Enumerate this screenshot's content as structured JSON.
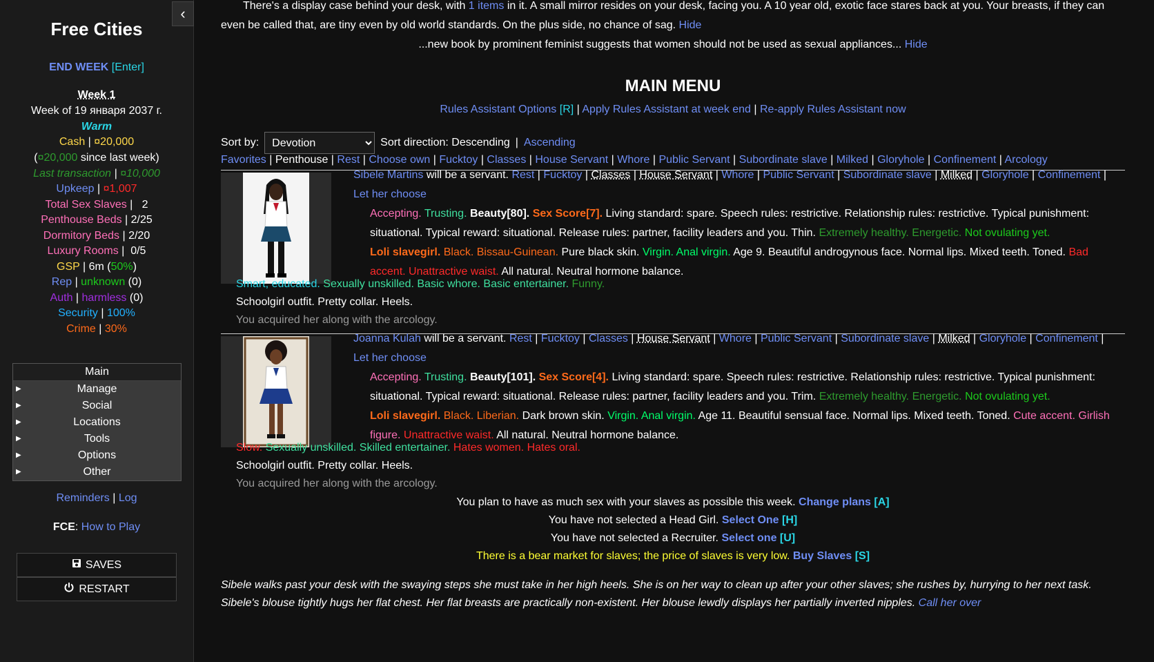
{
  "sidebar": {
    "title": "Free Cities",
    "end_week": "END WEEK",
    "end_week_key": "[Enter]",
    "week": "Week 1",
    "date": "Week of 19 января 2037 г.",
    "weather": "Warm",
    "cash_label": "Cash",
    "cash_value": "¤20,000",
    "cash_change": "¤20,000",
    "since_last_week": "since last week)",
    "last_tx_label": "Last transaction",
    "last_tx_value": "¤10,000",
    "upkeep_label": "Upkeep",
    "upkeep_value": "¤1,007",
    "sex_slaves_label": "Total Sex Slaves",
    "sex_slaves_value": "2",
    "penthouse_beds_label": "Penthouse Beds",
    "penthouse_beds_value": "2/25",
    "dormitory_beds_label": "Dormitory Beds",
    "dormitory_beds_value": "2/20",
    "luxury_rooms_label": "Luxury Rooms",
    "luxury_rooms_value": "0/5",
    "gsp_label": "GSP",
    "gsp_value": "6m",
    "gsp_pct": "50%",
    "rep_label": "Rep",
    "rep_value": "unknown",
    "rep_num": "(0)",
    "auth_label": "Auth",
    "auth_value": "harmless",
    "auth_num": "(0)",
    "security_label": "Security",
    "security_value": "100%",
    "crime_label": "Crime",
    "crime_value": "30%",
    "menu": [
      "Main",
      "Manage",
      "Social",
      "Locations",
      "Tools",
      "Options",
      "Other"
    ],
    "reminders": "Reminders",
    "log": "Log",
    "fce": "FCE",
    "how_to_play": "How to Play",
    "saves": "SAVES",
    "restart": "RESTART"
  },
  "main": {
    "desk_text": "There's a display case behind your desk, with",
    "items_link": "1 items",
    "desk_text2": "in it. A small mirror resides on your desk, facing you. A 10 year old, exotic face stares back at you. Your breasts, if they can",
    "desk_text3": "even be called that, are tiny even by old world standards. On the plus side, no chance of sag.",
    "hide": "Hide",
    "news": "...new book by prominent feminist suggests that women should not be used as sexual appliances...",
    "menu_title": "MAIN MENU",
    "rules_assistant": "Rules Assistant Options",
    "rules_key": "[R]",
    "apply_rules": "Apply Rules Assistant at week end",
    "reapply_rules": "Re-apply Rules Assistant now",
    "sort_by": "Sort by:",
    "sort_selected": "Devotion",
    "sort_direction": "Sort direction: Descending",
    "ascending": "Ascending",
    "filters": [
      "Favorites",
      "Penthouse",
      "Rest",
      "Choose own",
      "Fucktoy",
      "Classes",
      "House Servant",
      "Whore",
      "Public Servant",
      "Subordinate slave",
      "Milked",
      "Gloryhole",
      "Confinement",
      "Arcology"
    ],
    "plan_text": "You plan to have as much sex with your slaves as possible this week.",
    "change_plans": "Change plans",
    "change_plans_key": "[A]",
    "headgirl_text": "You have not selected a Head Girl.",
    "select_one_h": "Select One",
    "key_h": "[H]",
    "recruiter_text": "You have not selected a Recruiter.",
    "select_one_u": "Select one",
    "key_u": "[U]",
    "market_text": "There is a bear market for slaves; the price of slaves is very low.",
    "buy_slaves": "Buy Slaves",
    "key_s": "[S]",
    "event_line1": "Sibele walks past your desk with the swaying steps she must take in her high heels. She is on her way to clean up after your other slaves; she rushes by, hurrying to her next task.",
    "event_line2": "Sibele's blouse tightly hugs her flat chest. Her flat breasts are practically non-existent. Her blouse lewdly displays her partially inverted nipples.",
    "call_her_over": "Call her over"
  },
  "slaves": [
    {
      "name": "Sibele Martins",
      "will_be": "will be a servant.",
      "assign": [
        "Rest",
        "Fucktoy",
        "Classes",
        "House Servant",
        "Whore",
        "Public Servant",
        "Subordinate slave",
        "Milked",
        "Gloryhole",
        "Confinement",
        "Let"
      ],
      "assign_wrap": "her choose",
      "accepting": "Accepting.",
      "trusting": "Trusting.",
      "beauty": "Beauty[80].",
      "sex_score": "Sex Score[7].",
      "rules1": "Living standard: spare. Speech rules: restrictive. Relationship rules: restrictive. Typical punishment:",
      "rules2": "situational. Typical reward: situational. Release rules: partner, facility leaders and you. Thin.",
      "health": "Extremely healthy. Energetic.",
      "ovulating": "Not ovulating yet.",
      "slavegirl": "Loli slavegirl.",
      "race": "Black.",
      "nation": "Bissau-Guinean.",
      "skin": "Pure black skin.",
      "virgin": "Virgin. Anal virgin.",
      "desc": "Age 9. Beautiful androgynous face. Normal lips. Mixed teeth. Toned.",
      "bad": "Bad",
      "bad2": "accent. Unattractive waist.",
      "natural": "All natural. Neutral hormone balance.",
      "intel": "Smart, educated.",
      "skills": "Sexually unskilled. Basic whore. Basic entertainer.",
      "quirk": "Funny.",
      "outfit": "Schoolgirl outfit. Pretty collar. Heels.",
      "acquired": "You acquired her along with the arcology."
    },
    {
      "name": "Joanna Kulah",
      "will_be": "will be a servant.",
      "assign": [
        "Rest",
        "Fucktoy",
        "Classes",
        "House Servant",
        "Whore",
        "Public Servant",
        "Subordinate slave",
        "Milked",
        "Gloryhole",
        "Confinement",
        "Let her"
      ],
      "assign_wrap": "choose",
      "accepting": "Accepting.",
      "trusting": "Trusting.",
      "beauty": "Beauty[101].",
      "sex_score": "Sex Score[4].",
      "rules1": "Living standard: spare. Speech rules: restrictive. Relationship rules: restrictive. Typical punishment:",
      "rules2": "situational. Typical reward: situational. Release rules: partner, facility leaders and you. Trim.",
      "health": "Extremely healthy. Energetic.",
      "ovulating": "Not ovulating yet.",
      "slavegirl": "Loli slavegirl.",
      "race": "Black.",
      "nation": "Liberian.",
      "skin": "Dark brown skin.",
      "virgin": "Virgin. Anal virgin.",
      "desc": "Age 11. Beautiful sensual face. Normal lips. Mixed teeth. Toned.",
      "accent": "Cute accent.",
      "girlish": "Girlish",
      "figure": "figure.",
      "waist": "Unattractive waist.",
      "natural": "All natural. Neutral hormone balance.",
      "slow": "Slow.",
      "skills": "Sexually unskilled. Skilled entertainer.",
      "flaws": "Hates women. Hates oral.",
      "outfit": "Schoolgirl outfit. Pretty collar. Heels.",
      "acquired": "You acquired her along with the arcology."
    }
  ]
}
